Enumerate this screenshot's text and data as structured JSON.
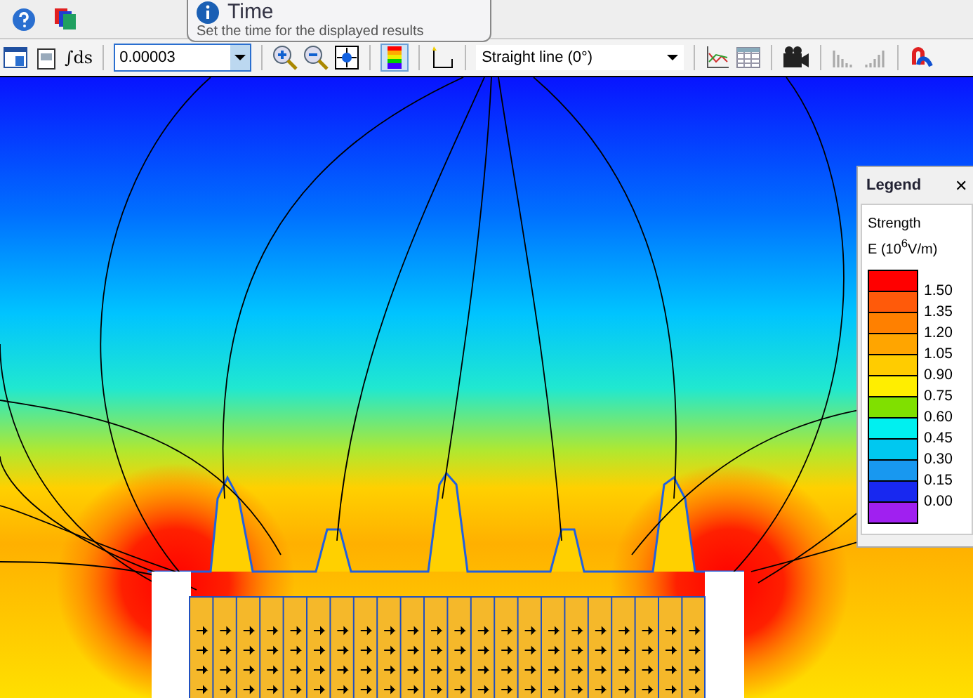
{
  "tooltip": {
    "title": "Time",
    "text": "Set the time for the displayed results"
  },
  "toolbar": {
    "time_value": "0.00003",
    "line_type": "Straight line (0°)",
    "integral_label": "∫ds"
  },
  "legend": {
    "title": "Legend",
    "close": "✕",
    "quantity": "Strength",
    "unit": "E (10$^{6}$V/m)",
    "ticks": [
      "1.50",
      "1.35",
      "1.20",
      "1.05",
      "0.90",
      "0.75",
      "0.60",
      "0.45",
      "0.30",
      "0.15",
      "0.00"
    ],
    "swatches": [
      {
        "color": "#ff0000"
      },
      {
        "color": "#ff5a0a"
      },
      {
        "color": "#ff8000"
      },
      {
        "color": "#ffa500"
      },
      {
        "color": "#ffcc00"
      },
      {
        "color": "#ffee00"
      },
      {
        "color": "#80e000"
      },
      {
        "color": "#00f0f0"
      },
      {
        "color": "#00c8f0"
      },
      {
        "color": "#1898f0"
      },
      {
        "color": "#1828f0"
      },
      {
        "color": "#a020f0"
      }
    ]
  }
}
